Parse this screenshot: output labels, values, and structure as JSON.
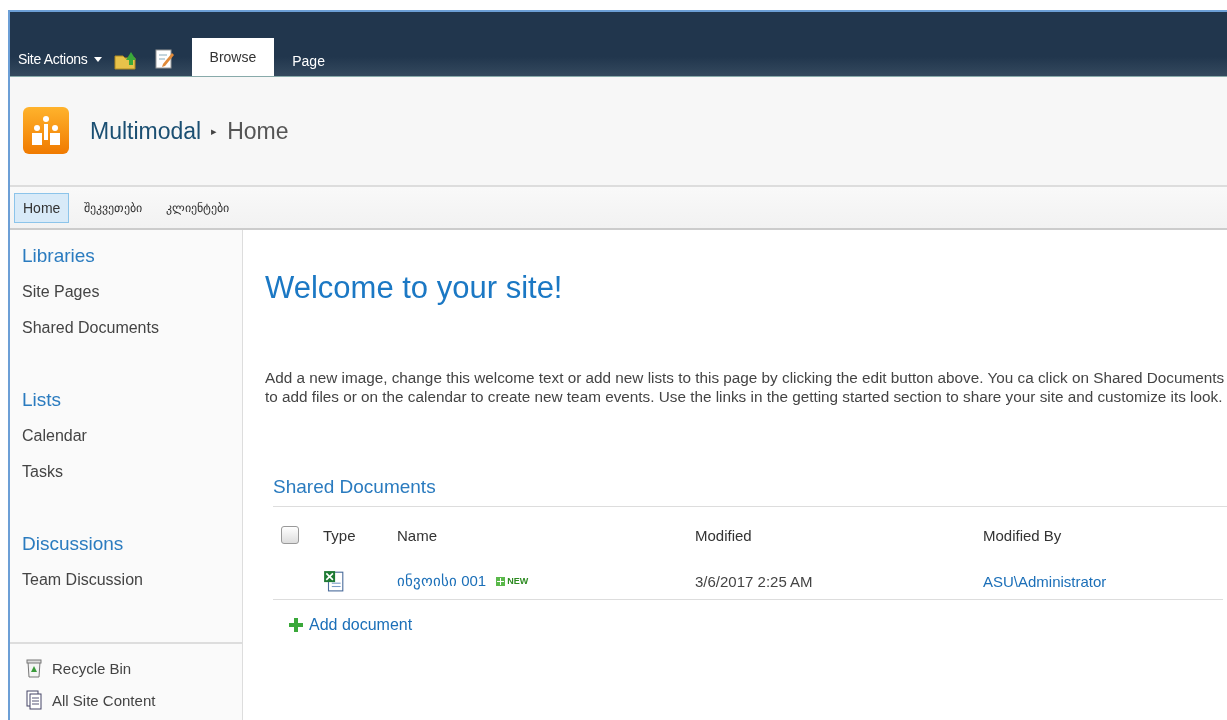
{
  "ribbon": {
    "site_actions": "Site Actions",
    "tabs": [
      {
        "label": "Browse",
        "selected": true
      },
      {
        "label": "Page",
        "selected": false
      }
    ]
  },
  "title_area": {
    "site": "Multimodal",
    "separator": "▸",
    "page": "Home"
  },
  "top_nav": [
    {
      "label": "Home",
      "selected": true
    },
    {
      "label": "შეკვეთები",
      "selected": false
    },
    {
      "label": "კლიენტები",
      "selected": false
    }
  ],
  "quick_launch": {
    "sections": [
      {
        "heading": "Libraries",
        "items": [
          "Site Pages",
          "Shared Documents"
        ]
      },
      {
        "heading": "Lists",
        "items": [
          "Calendar",
          "Tasks"
        ]
      },
      {
        "heading": "Discussions",
        "items": [
          "Team Discussion"
        ]
      }
    ],
    "footer": [
      {
        "kind": "recycle",
        "label": "Recycle Bin"
      },
      {
        "kind": "content",
        "label": "All Site Content"
      }
    ]
  },
  "main": {
    "heading": "Welcome to your site!",
    "text": "Add a new image, change this welcome text or add new lists to this page by clicking the edit button above. You ca click on Shared Documents to add files or on the calendar to create new team events. Use the links in the getting started section to share your site and customize its look.",
    "library": {
      "title": "Shared Documents",
      "select_all": {
        "checked": false
      },
      "columns": [
        "Type",
        "Name",
        "Modified",
        "Modified By"
      ],
      "rows": [
        {
          "kind": "excel",
          "name": "ინვოისი 001",
          "badge": "NEW",
          "modified": "3/6/2017 2:25 AM",
          "modified_by": "ASU\\Administrator"
        }
      ],
      "add": "Add document"
    }
  }
}
